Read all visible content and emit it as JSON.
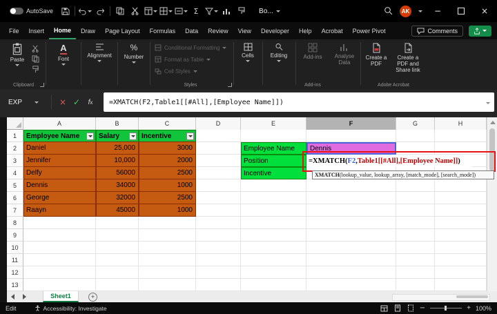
{
  "title_bar": {
    "autosave_label": "AutoSave",
    "workbook_name": "Bo...",
    "avatar_initials": "AK"
  },
  "ribbon_tabs": {
    "items": [
      "File",
      "Insert",
      "Home",
      "Draw",
      "Page Layout",
      "Formulas",
      "Data",
      "Review",
      "View",
      "Developer",
      "Help",
      "Acrobat",
      "Power Pivot"
    ],
    "active": "Home",
    "comments_label": "Comments"
  },
  "ribbon": {
    "paste_label": "Paste",
    "clipboard_label": "Clipboard",
    "font_label": "Font",
    "alignment_label": "Alignment",
    "number_label": "Number",
    "styles_items": [
      "Conditional Formatting",
      "Format as Table",
      "Cell Styles"
    ],
    "styles_label": "Styles",
    "cells_label": "Cells",
    "editing_label": "Editing",
    "addins_button_label": "Add-ins",
    "addins_group_label": "Add-ins",
    "analyse_label": "Analyse Data",
    "create_pdf_label": "Create a PDF",
    "create_pdf_share_label": "Create a PDF and Share link",
    "acrobat_group_label": "Adobe Acrobat"
  },
  "formula_bar": {
    "name_box": "EXP",
    "formula": "=XMATCH(F2,Table1[[#All],[Employee Name]])"
  },
  "grid": {
    "column_letters": [
      "A",
      "B",
      "C",
      "D",
      "E",
      "F",
      "G",
      "H"
    ],
    "row_numbers": [
      "1",
      "2",
      "3",
      "4",
      "5",
      "6",
      "7",
      "8",
      "9",
      "10",
      "11",
      "12",
      "13"
    ],
    "selected_column": "F"
  },
  "employee_table": {
    "headers": [
      "Employee Name",
      "Salary",
      "Incentive"
    ],
    "rows": [
      [
        "Daniel",
        "25,000",
        "3000"
      ],
      [
        "Jennifer",
        "10,000",
        "2000"
      ],
      [
        "Delfy",
        "56000",
        "2500"
      ],
      [
        "Dennis",
        "34000",
        "1000"
      ],
      [
        "George",
        "32000",
        "2500"
      ],
      [
        "Raayn",
        "45000",
        "1000"
      ]
    ]
  },
  "lookup_panel": {
    "labels": [
      "Employee Name",
      "Position",
      "Incentive"
    ],
    "employee_value": "Dennis",
    "formula_parts": [
      {
        "text": "=XMATCH(",
        "color": "#000000"
      },
      {
        "text": "F2",
        "color": "#2e5bd7"
      },
      {
        "text": ",",
        "color": "#000000"
      },
      {
        "text": "Table1[[#All],[Employee Name]]",
        "color": "#c00000"
      },
      {
        "text": ")",
        "color": "#000000"
      }
    ],
    "tooltip": {
      "bold": "XMATCH",
      "rest": "(lookup_value, lookup_array, [match_mode], [search_mode])"
    }
  },
  "sheet_bar": {
    "active_tab": "Sheet1"
  },
  "status_bar": {
    "mode": "Edit",
    "accessibility": "Accessibility: Investigate",
    "zoom": "100%"
  },
  "colors": {
    "accent_green": "#2ea566",
    "table_orange": "#c55a11",
    "table_border": "#8a2f05",
    "header_green": "#12c33c",
    "lookup_green": "#00df3c",
    "value_magenta": "#e06be0",
    "annotation_red": "#e81212",
    "ref_blue": "#2e5bd7",
    "ref_red": "#c00000",
    "avatar_red": "#d83b01"
  }
}
